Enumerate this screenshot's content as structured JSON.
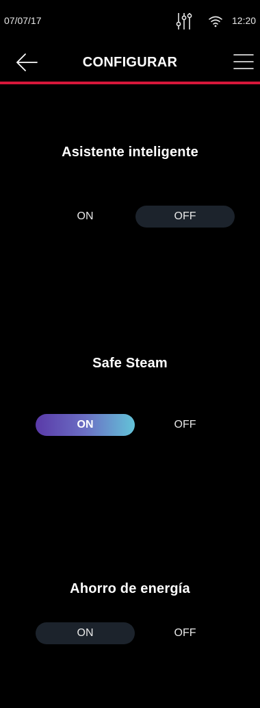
{
  "status_bar": {
    "date": "07/07/17",
    "time": "12:20",
    "icons": [
      "mixer-icon",
      "wifi-icon"
    ]
  },
  "header": {
    "title": "CONFIGURAR",
    "back_icon": "arrow-left-icon",
    "menu_icon": "hamburger-menu-icon",
    "accent_color": "#d5173a"
  },
  "settings": [
    {
      "title": "Asistente inteligente",
      "on_label": "ON",
      "off_label": "OFF",
      "state": "OFF"
    },
    {
      "title": "Safe Steam",
      "on_label": "ON",
      "off_label": "OFF",
      "state": "ON"
    },
    {
      "title": "Ahorro de energía",
      "on_label": "ON",
      "off_label": "OFF",
      "state": "OFF"
    }
  ],
  "colors": {
    "background": "#000000",
    "inactive_pill": "#1c232c",
    "active_gradient_start": "#5a3aa8",
    "active_gradient_end": "#63c3d8"
  }
}
